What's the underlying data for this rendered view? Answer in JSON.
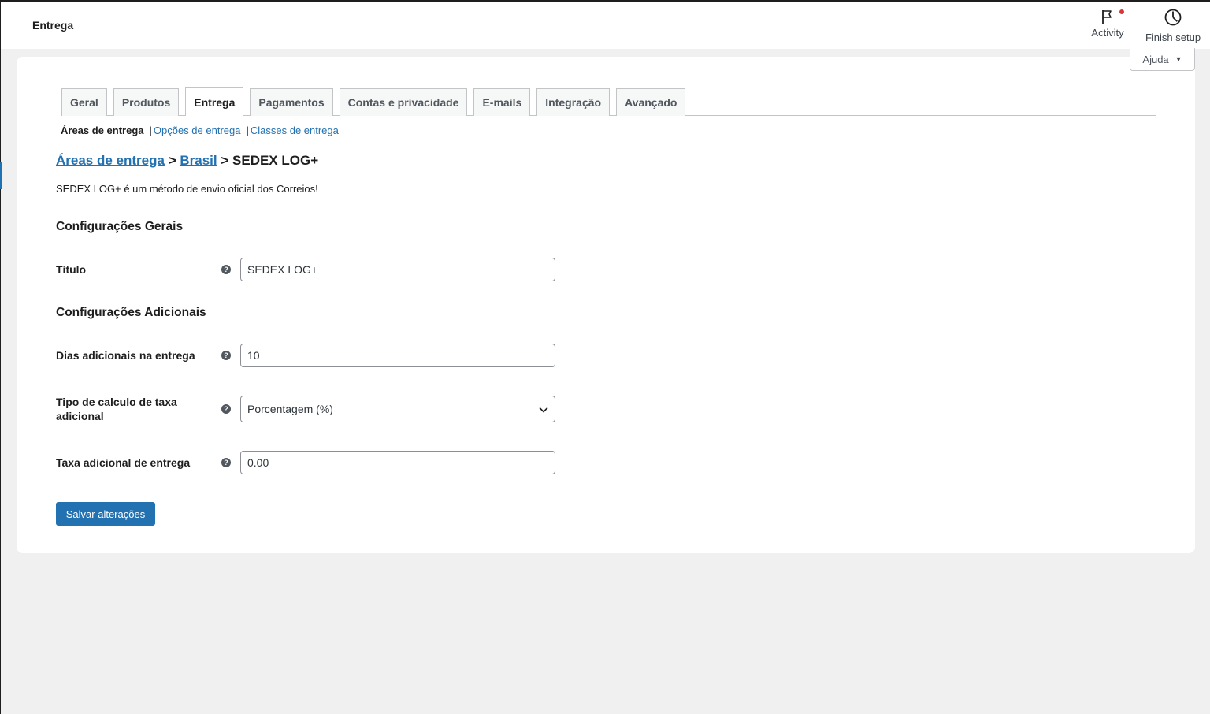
{
  "header": {
    "title": "Entrega",
    "actions": {
      "activity": "Activity",
      "finish_setup": "Finish setup"
    },
    "help": "Ajuda"
  },
  "tabs": [
    {
      "label": "Geral",
      "active": false
    },
    {
      "label": "Produtos",
      "active": false
    },
    {
      "label": "Entrega",
      "active": true
    },
    {
      "label": "Pagamentos",
      "active": false
    },
    {
      "label": "Contas e privacidade",
      "active": false
    },
    {
      "label": "E-mails",
      "active": false
    },
    {
      "label": "Integração",
      "active": false
    },
    {
      "label": "Avançado",
      "active": false
    }
  ],
  "subnav": {
    "current": "Áreas de entrega",
    "separator": "|",
    "links": [
      "Opções de entrega",
      "Classes de entrega"
    ]
  },
  "breadcrumb": {
    "zones_link": "Áreas de entrega",
    "arrow": ">",
    "zone_link": "Brasil",
    "method": "SEDEX LOG+"
  },
  "description": "SEDEX LOG+ é um método de envio oficial dos Correios!",
  "sections": {
    "general": "Configurações Gerais",
    "additional": "Configurações Adicionais"
  },
  "fields": {
    "title": {
      "label": "Título",
      "value": "SEDEX LOG+"
    },
    "extra_days": {
      "label": "Dias adicionais na entrega",
      "value": "10"
    },
    "fee_type": {
      "label": "Tipo de calculo de taxa adicional",
      "value": "Porcentagem (%)"
    },
    "fee": {
      "label": "Taxa adicional de entrega",
      "value": "0.00"
    }
  },
  "tooltip_glyph": "?",
  "save_button": "Salvar alterações",
  "colors": {
    "accent": "#2271b1",
    "background": "#f0f0f1",
    "notification": "#d63638"
  }
}
